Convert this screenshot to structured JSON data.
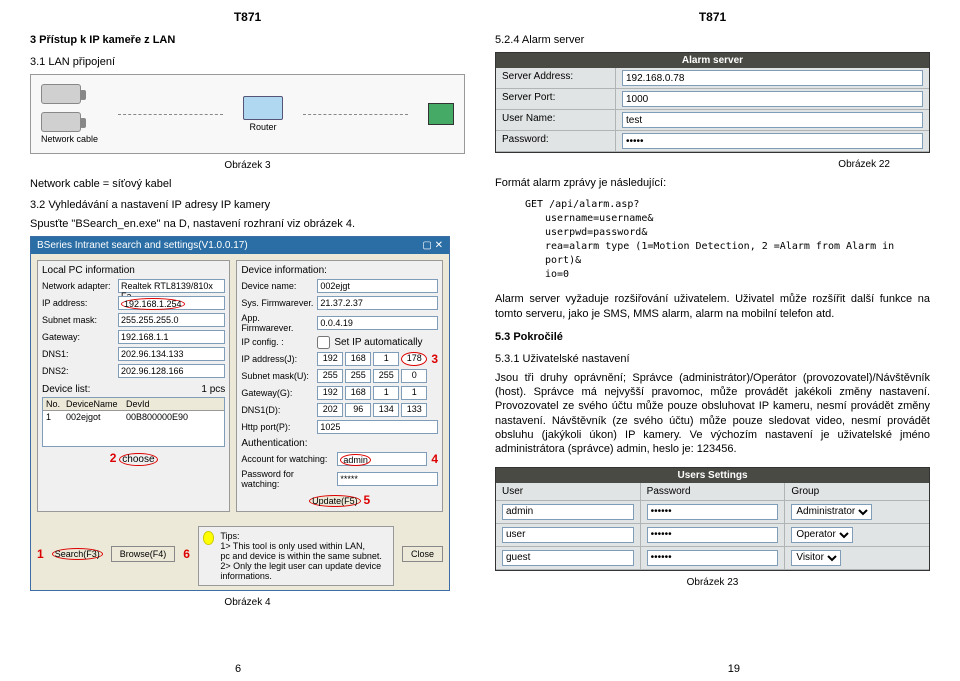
{
  "header": {
    "left": "T871",
    "right": "T871"
  },
  "left": {
    "sec3": "3  Přístup k IP kameře z LAN",
    "sec31": "3.1  LAN připojení",
    "diagram": {
      "cable_label": "Network cable",
      "router_label": "Router"
    },
    "obr3": "Obrázek 3",
    "note": "Network cable = síťový kabel",
    "sec32": "3.2  Vyhledávání a nastavení IP adresy IP kamery",
    "spustte": "Spusťte \"BSearch_en.exe\" na D, nastavení rozhraní viz obrázek 4.",
    "bsearch": {
      "title": "BSeries Intranet search and settings(V1.0.0.17)",
      "localpc": "Local PC information",
      "devinfo": "Device information:",
      "netadapt_lbl": "Network adapter:",
      "netadapt": "Realtek RTL8139/810x Fa",
      "devname_lbl": "Device name:",
      "devname": "002ejgt",
      "ipaddr_lbl": "IP address:",
      "ipaddr": "192.168.1.254",
      "sysfw_lbl": "Sys. Firmwarever.",
      "sysfw": "21.37.2.37",
      "subnet_lbl": "Subnet mask:",
      "subnet": "255.255.255.0",
      "appfw_lbl": "App. Firmwarever.",
      "appfw": "0.0.4.19",
      "gateway_lbl": "Gateway:",
      "gateway": "192.168.1.1",
      "ipconfig": "IP config. :",
      "setauto": "Set IP automatically",
      "dns1_lbl": "DNS1:",
      "dns1": "202.96.134.133",
      "ipaddr2_lbl": "IP address(J):",
      "ip2": [
        "192",
        "168",
        "1",
        "178"
      ],
      "dns2_lbl": "DNS2:",
      "dns2": "202.96.128.166",
      "submask2_lbl": "Subnet mask(U):",
      "sm2": [
        "255",
        "255",
        "255",
        "0"
      ],
      "gw2_lbl": "Gateway(G):",
      "gw2": [
        "192",
        "168",
        "1",
        "1"
      ],
      "devlist": "Device list:",
      "devcount": "1 pcs",
      "dns1x_lbl": "DNS1(D):",
      "dns1x": [
        "202",
        "96",
        "134",
        "133"
      ],
      "listhdr": {
        "no": "No.",
        "devname": "DeviceName",
        "devid": "DevId"
      },
      "listrow": {
        "no": "1",
        "devname": "002ejgot",
        "devid": "00B800000E90"
      },
      "httpport_lbl": "Http port(P):",
      "httpport": "1025",
      "choose": "choose",
      "auth": "Authentication:",
      "acctw_lbl": "Account for watching:",
      "acctw": "admin",
      "passw_lbl": "Password for watching:",
      "passw": "*****",
      "update": "Update(F5)",
      "tips_title": "Tips:",
      "tip1": "1> This tool is only used within LAN,",
      "tip2": "pc and device is within the same subnet.",
      "tip3": "2> Only the legit user can update device informations.",
      "search": "Search(F3)",
      "browse": "Browse(F4)",
      "close": "Close"
    },
    "obr4": "Obrázek 4",
    "pagenum": "6"
  },
  "right": {
    "sec524": "5.2.4 Alarm server",
    "alarm_server": {
      "title": "Alarm server",
      "addr_lbl": "Server Address:",
      "addr": "192.168.0.78",
      "port_lbl": "Server Port:",
      "port": "1000",
      "user_lbl": "User Name:",
      "user": "test",
      "pass_lbl": "Password:",
      "pass": "•••••"
    },
    "obr22": "Obrázek 22",
    "formatline": "Formát alarm zprávy je následující:",
    "api": {
      "l1": "GET /api/alarm.asp?",
      "l2": "username=username&",
      "l3": "userpwd=password&",
      "l4": "rea=alarm type (1=Motion Detection, 2 =Alarm from Alarm in port)&",
      "l5": "io=0"
    },
    "ext_para": "Alarm server vyžaduje rozšiřování uživatelem. Uživatel může rozšířit další funkce na tomto serveru, jako je SMS, MMS alarm, alarm na mobilní telefon atd.",
    "sec53": "5.3    Pokročilé",
    "sec531": "5.3.1 Uživatelské nastavení",
    "users_para": "Jsou tři druhy oprávnění; Správce (administrátor)/Operátor (provozovatel)/Návštěvník (host). Správce má nejvyšší pravomoc, může provádět jakékoli změny nastavení. Provozovatel ze svého účtu může pouze obsluhovat IP kameru, nesmí provádět změny nastavení. Návštěvník (ze svého účtu) může pouze sledovat video, nesmí provádět obsluhu (jakýkoli úkon) IP kamery. Ve výchozím nastavení je uživatelské jméno administrátora (správce) admin, heslo je: 123456.",
    "users_settings": {
      "title": "Users Settings",
      "hdr": {
        "user": "User",
        "pass": "Password",
        "group": "Group"
      },
      "rows": [
        {
          "user": "admin",
          "pass": "••••••",
          "group": "Administrator"
        },
        {
          "user": "user",
          "pass": "••••••",
          "group": "Operator"
        },
        {
          "user": "guest",
          "pass": "••••••",
          "group": "Visitor"
        }
      ]
    },
    "obr23": "Obrázek 23",
    "pagenum": "19"
  }
}
